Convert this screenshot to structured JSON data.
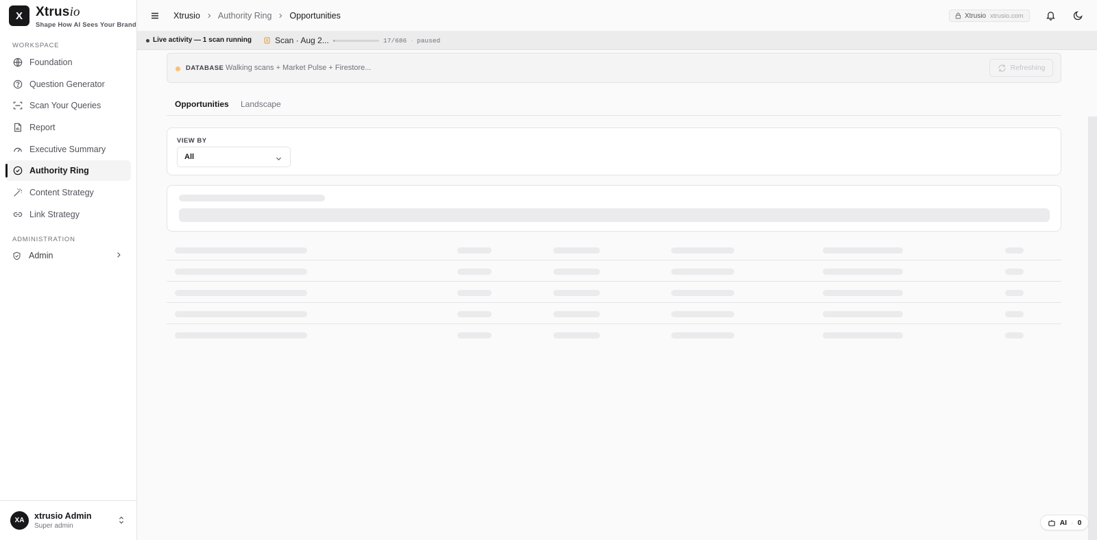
{
  "brand": {
    "logo_letter": "X",
    "name_main": "Xtrus",
    "name_italic": "io",
    "tagline": "Shape How AI Sees Your Brand"
  },
  "sidebar": {
    "workspace_label": "WORKSPACE",
    "items": [
      {
        "label": "Foundation",
        "icon": "globe-icon",
        "active": false
      },
      {
        "label": "Question Generator",
        "icon": "help-circle-icon",
        "active": false
      },
      {
        "label": "Scan Your Queries",
        "icon": "scan-icon",
        "active": false
      },
      {
        "label": "Report",
        "icon": "file-chart-icon",
        "active": false
      },
      {
        "label": "Executive Summary",
        "icon": "gauge-icon",
        "active": false
      },
      {
        "label": "Authority Ring",
        "icon": "circle-check-icon",
        "active": true
      },
      {
        "label": "Content Strategy",
        "icon": "wand-icon",
        "active": false
      },
      {
        "label": "Link Strategy",
        "icon": "link-icon",
        "active": false
      }
    ],
    "admin_label": "ADMINISTRATION",
    "admin_item": "Admin"
  },
  "user": {
    "initials": "XA",
    "name": "xtrusio Admin",
    "role": "Super admin"
  },
  "topbar": {
    "breadcrumb": [
      "Xtrusio",
      "Authority Ring",
      "Opportunities"
    ],
    "site_name": "Xtrusio",
    "site_domain": "xtrusio.com"
  },
  "activity": {
    "label": "Live activity — 1 scan running",
    "scan_name": "Scan · Aug 2...",
    "progress_fraction": 0.0248,
    "count": "17/686",
    "separator": "·",
    "status": "paused"
  },
  "database": {
    "label": "DATABASE",
    "text": "Walking scans + Market Pulse + Firestore...",
    "button": "Refreshing"
  },
  "tabs": [
    "Opportunities",
    "Landscape"
  ],
  "view_by": {
    "label": "VIEW BY",
    "value": "All"
  },
  "ai_badge": {
    "label": "AI",
    "separator": "·",
    "count": "0"
  },
  "colors": {
    "accent": "#18181b",
    "db_status_dot": "#fbbf77",
    "skeleton": "#ebebed"
  }
}
